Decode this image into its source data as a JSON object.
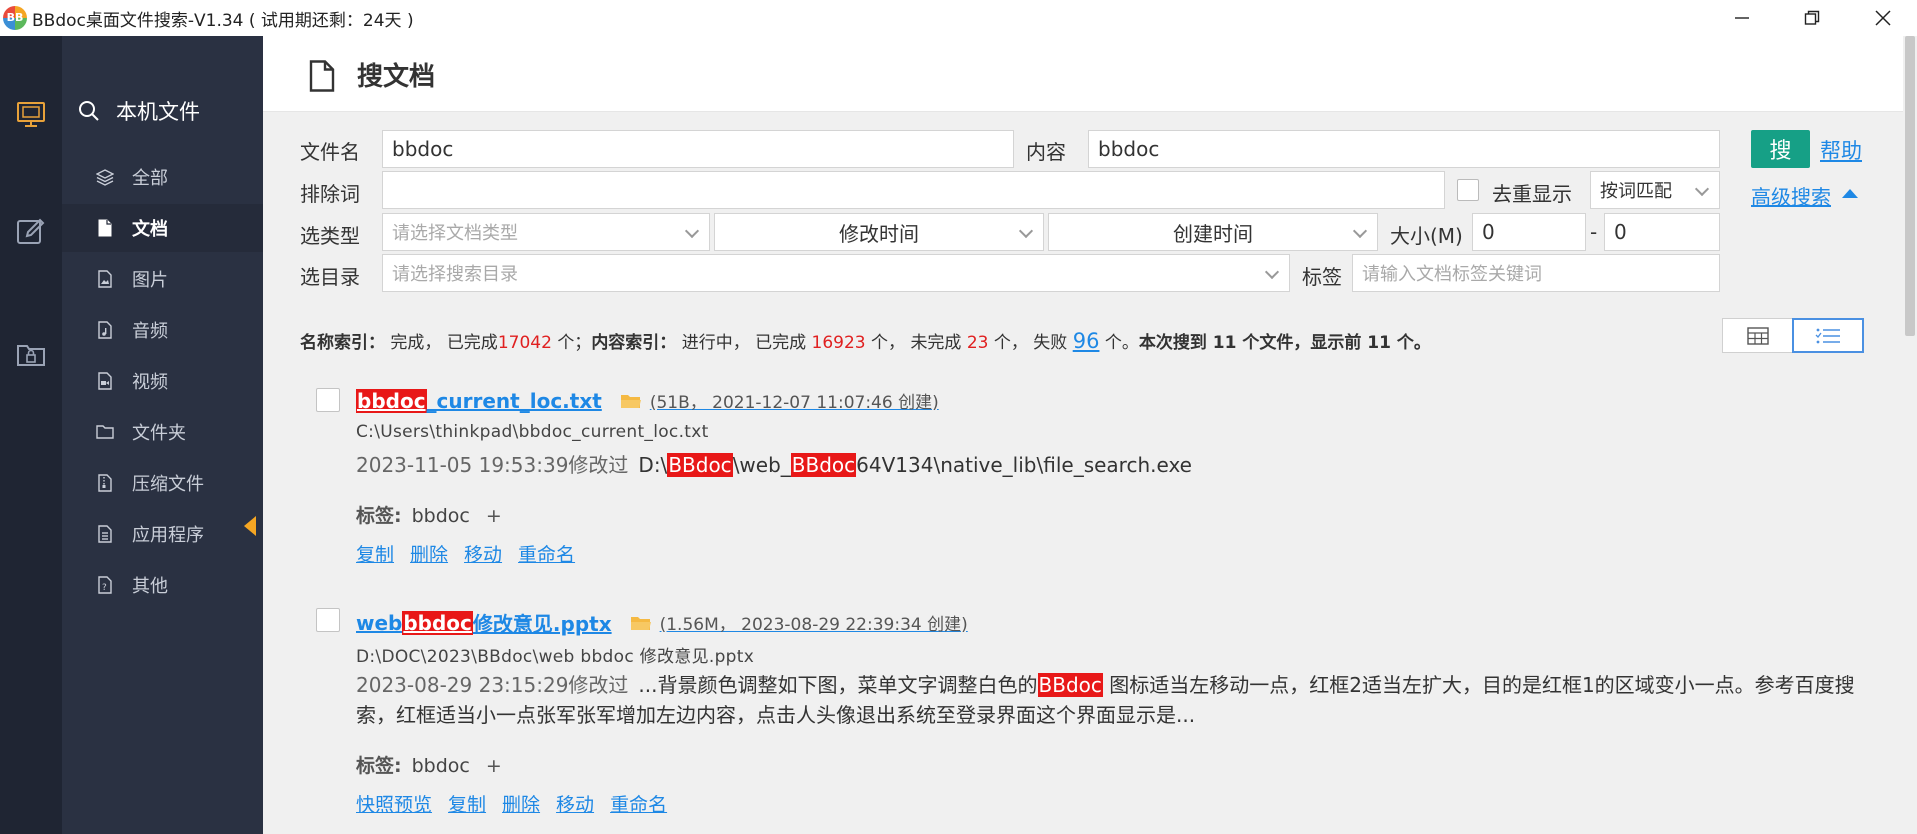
{
  "window": {
    "title": "BBdoc桌面文件搜索-V1.34 ( 试用期还剩：24天 )",
    "icon_text": "BB"
  },
  "rail": {
    "items": [
      "monitor-icon",
      "edit-icon",
      "folder-lock-icon"
    ]
  },
  "sidebar": {
    "header": "本机文件",
    "items": [
      {
        "label": "全部",
        "icon": "layers-icon"
      },
      {
        "label": "文档",
        "icon": "document-icon",
        "active": true
      },
      {
        "label": "图片",
        "icon": "image-icon"
      },
      {
        "label": "音频",
        "icon": "audio-icon"
      },
      {
        "label": "视频",
        "icon": "video-icon"
      },
      {
        "label": "文件夹",
        "icon": "folder-icon"
      },
      {
        "label": "压缩文件",
        "icon": "archive-icon"
      },
      {
        "label": "应用程序",
        "icon": "app-icon"
      },
      {
        "label": "其他",
        "icon": "other-icon"
      }
    ]
  },
  "header": {
    "title": "搜文档"
  },
  "form": {
    "filename_label": "文件名",
    "filename_value": "bbdoc",
    "content_label": "内容",
    "content_value": "bbdoc",
    "exclude_label": "排除词",
    "exclude_value": "",
    "dedupe_label": "去重显示",
    "match_mode": "按词匹配",
    "type_label": "选类型",
    "type_placeholder": "请选择文档类型",
    "modified_time": "修改时间",
    "created_time": "创建时间",
    "size_label": "大小(M)",
    "size_min": "0",
    "size_sep": "-",
    "size_max": "0",
    "dir_label": "选目录",
    "dir_placeholder": "请选择搜索目录",
    "tag_label": "标签",
    "tag_placeholder": "请输入文档标签关键词",
    "search_button": "搜",
    "help_link": "帮助",
    "advanced_link": "高级搜索"
  },
  "status": {
    "name_index_label": "名称索引：",
    "name_index_state": "完成，",
    "done_prefix": "已完成",
    "name_done_count": "17042",
    "unit_sep": "个；",
    "content_index_label": "内容索引：",
    "content_index_state": "进行中，",
    "content_done_count": "16923",
    "unit_comma": "个，",
    "undone_prefix": "未完成",
    "undone_count": "23",
    "fail_prefix": "失败",
    "fail_count": "96",
    "unit_dot": "个。",
    "summary": "本次搜到 11 个文件，显示前 11 个。"
  },
  "results": [
    {
      "title_hl": "bbdoc",
      "title_rest": "_current_loc.txt",
      "meta": "(51B， 2021-12-07 11:07:46 创建)",
      "path": "C:\\Users\\thinkpad\\bbdoc_current_loc.txt",
      "modified": "2023-11-05 19:53:39修改过",
      "snip_a": "D:\\",
      "snip_hl1": "BBdoc",
      "snip_b": "\\web_",
      "snip_hl2": "BBdoc",
      "snip_c": "64V134\\native_lib\\file_search.exe",
      "tag_label": "标签:",
      "tag_value": "bbdoc",
      "tag_add": "+",
      "actions": [
        "复制",
        "删除",
        "移动",
        "重命名"
      ]
    },
    {
      "title_pre": "web ",
      "title_hl": "bbdoc",
      "title_rest": " 修改意见.pptx",
      "meta": "(1.56M， 2023-08-29 22:39:34 创建)",
      "path": "D:\\DOC\\2023\\BBdoc\\web bbdoc 修改意见.pptx",
      "modified": "2023-08-29 23:15:29修改过",
      "snip_a": "...背景颜色调整如下图，菜单文字调整白色的",
      "snip_hl1": "BBdoc",
      "snip_b": " 图标适当左移动一点，红框2适当左扩大，目的是红框1的区域变小一点。参考百度搜索，红框适当小一点张军张军增加左边内容，点击人头像退出系统至登录界面这个界面显示是...",
      "tag_label": "标签:",
      "tag_value": "bbdoc",
      "tag_add": "+",
      "actions": [
        "快照预览",
        "复制",
        "删除",
        "移动",
        "重命名"
      ]
    }
  ],
  "colors": {
    "rail": "#1f2533",
    "sidebar": "#2a3142",
    "accent_green": "#16a086",
    "link_blue": "#1e88e5",
    "highlight_red": "#e81818",
    "arrow_orange": "#f5a623"
  }
}
